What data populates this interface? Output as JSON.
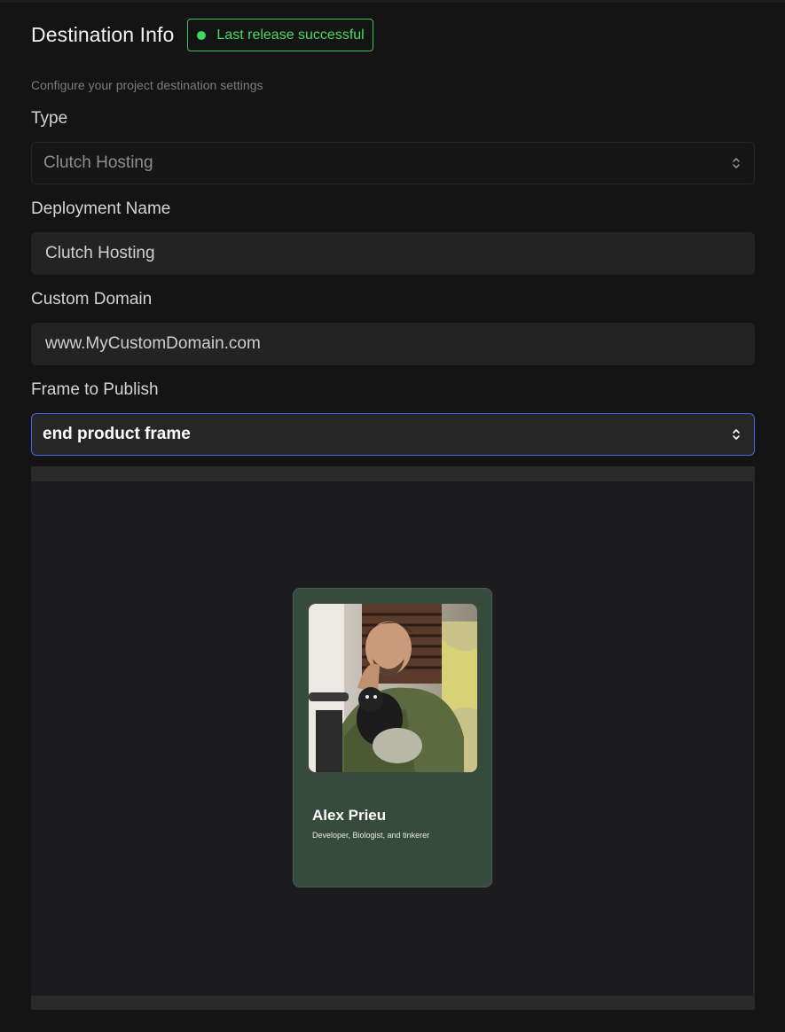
{
  "header": {
    "title": "Destination Info",
    "status_badge": "Last release successful"
  },
  "subtitle": "Configure your project destination settings",
  "form": {
    "type": {
      "label": "Type",
      "value": "Clutch Hosting"
    },
    "deployment_name": {
      "label": "Deployment Name",
      "value": "Clutch Hosting"
    },
    "custom_domain": {
      "label": "Custom Domain",
      "value": "www.MyCustomDomain.com"
    },
    "frame_to_publish": {
      "label": "Frame to Publish",
      "value": "end product frame"
    }
  },
  "preview": {
    "card": {
      "name": "Alex Prieu",
      "description": "Developer, Biologist, and tinkerer"
    }
  },
  "colors": {
    "success": "#4cd964",
    "focus_border": "#4664e6",
    "card_bg": "#364b3c"
  },
  "icons": [
    "status-dot-icon",
    "chevron-up-down-icon"
  ]
}
